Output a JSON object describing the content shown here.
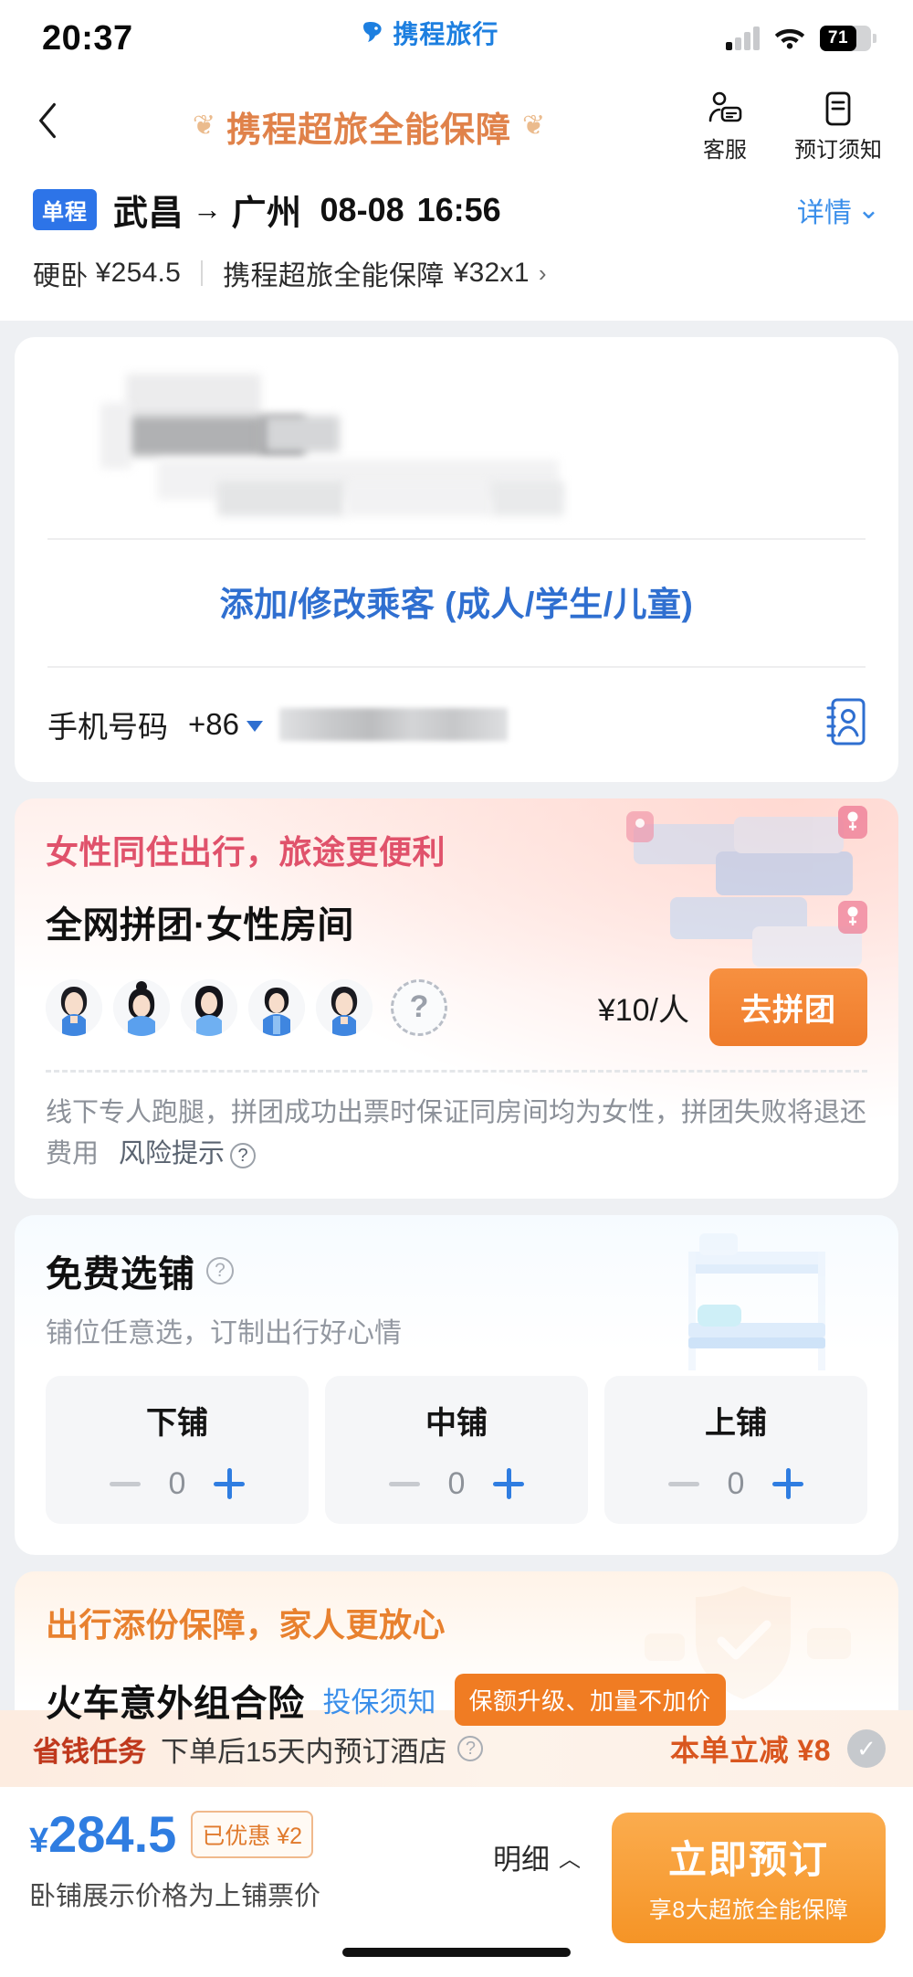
{
  "statusbar": {
    "time": "20:37",
    "brand": "携程旅行",
    "battery": "71",
    "signal_icon": "signal-bars-icon",
    "wifi_icon": "wifi-icon",
    "battery_icon": "battery-icon"
  },
  "navbar": {
    "back_icon": "chevron-left-icon",
    "title": "携程超旅全能保障",
    "laurel_left": "❦",
    "laurel_right": "❦",
    "actions": [
      {
        "label": "客服",
        "icon": "customer-service-icon"
      },
      {
        "label": "预订须知",
        "icon": "booking-notice-icon"
      }
    ]
  },
  "trip": {
    "tag": "单程",
    "from": "武昌",
    "arrow": "→",
    "to": "广州",
    "date": "08-08",
    "time": "16:56",
    "detail_label": "详情",
    "detail_caret": "⌄",
    "seat_class": "硬卧",
    "seat_price": "¥254.5",
    "insurance_name": "携程超旅全能保障",
    "insurance_price": "¥32x1",
    "chevron": "›"
  },
  "passenger": {
    "add_link": "添加/修改乘客 (成人/学生/儿童)",
    "phone_label": "手机号码",
    "country_code": "+86",
    "contact_icon": "contact-book-icon",
    "name_redacted": true,
    "phone_redacted": true
  },
  "women_room": {
    "headline": "女性同住出行，旅途更便利",
    "subtitle": "全网拼团·女性房间",
    "avatar_count": 5,
    "placeholder_glyph": "?",
    "price": "¥10/人",
    "cta": "去拼团",
    "note": "线下专人跑腿，拼团成功出票时保证同房间均为女性，拼团失败将退还费用",
    "risk_link": "风险提示",
    "risk_icon": "question-circle-icon",
    "deco_icon": "female-room-illustration"
  },
  "berth": {
    "title": "免费选铺",
    "title_icon": "question-circle-icon",
    "subtitle": "铺位任意选，订制出行好心情",
    "deco_icon": "bunk-bed-illustration",
    "options": [
      {
        "name": "下铺",
        "value": "0",
        "minus": "−",
        "plus": "+"
      },
      {
        "name": "中铺",
        "value": "0",
        "minus": "−",
        "plus": "+"
      },
      {
        "name": "上铺",
        "value": "0",
        "minus": "−",
        "plus": "+"
      }
    ]
  },
  "insurance": {
    "headline": "出行添份保障，家人更放心",
    "name": "火车意外组合险",
    "link": "投保须知",
    "badge": "保额升级、加量不加价",
    "deco_icon": "shield-check-illustration"
  },
  "promo": {
    "tag": "省钱任务",
    "text": "下单后15天内预订酒店",
    "info_icon": "question-circle-icon",
    "save_text": "本单立减 ¥8",
    "check_icon": "check-circle-icon",
    "check_glyph": "✓"
  },
  "checkout": {
    "currency": "¥",
    "total": "284.5",
    "discount_badge": "已优惠 ¥2",
    "note": "卧铺展示价格为上铺票价",
    "detail_label": "明细",
    "detail_caret": "︿",
    "button_main": "立即预订",
    "button_sub": "享8大超旅全能保障"
  },
  "colors": {
    "brand_blue": "#1d7fe0",
    "accent_orange": "#ef7c2c",
    "title_orange": "#e0824a",
    "pink": "#e0526b",
    "link_blue": "#3b8fea",
    "price_blue": "#2f7de1",
    "tag_blue": "#2d74e8"
  }
}
